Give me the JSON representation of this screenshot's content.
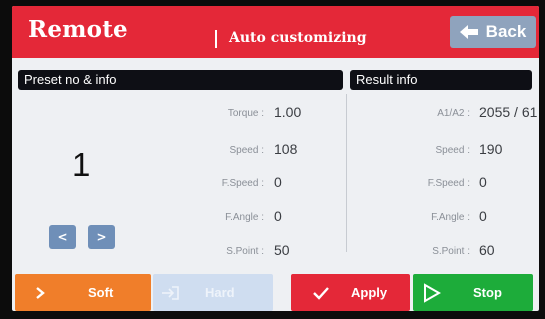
{
  "header": {
    "title": "Remote",
    "separator": "|",
    "subtitle": "Auto customizing",
    "back_label": "Back"
  },
  "preset_panel": {
    "heading": "Preset no & info",
    "preset_number": "1",
    "prev_label": "<",
    "next_label": ">",
    "rows": [
      {
        "label": "Torque :",
        "value": "1.00"
      },
      {
        "label": "Speed :",
        "value": "108"
      },
      {
        "label": "F.Speed :",
        "value": "0"
      },
      {
        "label": "F.Angle :",
        "value": "0"
      },
      {
        "label": "S.Point :",
        "value": "50"
      }
    ]
  },
  "result_panel": {
    "heading": "Result info",
    "rows": [
      {
        "label": "A1/A2 :",
        "value": "2055 / 61"
      },
      {
        "label": "Speed :",
        "value": "190"
      },
      {
        "label": "F.Speed :",
        "value": "0"
      },
      {
        "label": "F.Angle :",
        "value": "0"
      },
      {
        "label": "S.Point :",
        "value": "60"
      }
    ]
  },
  "buttons": {
    "soft_label": "Soft",
    "hard_label": "Hard",
    "apply_label": "Apply",
    "stop_label": "Stop"
  },
  "icons": {
    "back": "arrow-left-icon",
    "soft": "chevron-right-icon",
    "hard": "enter-arrow-icon",
    "apply": "checkmark-icon",
    "stop": "play-triangle-icon"
  },
  "colors": {
    "header": "#e42838",
    "back_button": "#8fa3bd",
    "panel_heading": "#0e0f15",
    "nav_button": "#6f8fb8",
    "soft": "#f07e2a",
    "hard_disabled": "#cfddf0",
    "apply": "#e42838",
    "stop": "#1dac3a"
  }
}
